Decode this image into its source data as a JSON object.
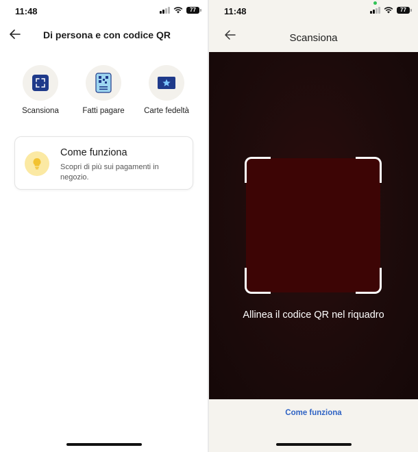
{
  "left": {
    "status": {
      "time": "11:48",
      "battery": "77"
    },
    "header": {
      "title": "Di persona e con codice QR"
    },
    "actions": [
      {
        "label": "Scansiona",
        "icon": "scan-icon"
      },
      {
        "label": "Fatti pagare",
        "icon": "qr-code-icon"
      },
      {
        "label": "Carte fedeltà",
        "icon": "loyalty-card-icon"
      }
    ],
    "info_card": {
      "title": "Come funziona",
      "description": "Scopri di più sui pagamenti in negozio.",
      "icon": "lightbulb-icon"
    }
  },
  "right": {
    "status": {
      "time": "11:48",
      "battery": "77"
    },
    "header": {
      "title": "Scansiona"
    },
    "scanner": {
      "hint": "Allinea il codice QR nel riquadro"
    },
    "footer": {
      "link": "Come funziona"
    }
  },
  "colors": {
    "accent_navy": "#1f3a8a",
    "link_blue": "#2f63c4",
    "bulb_yellow": "#fbe9a3",
    "camera_bg": "#1d0b0b"
  }
}
